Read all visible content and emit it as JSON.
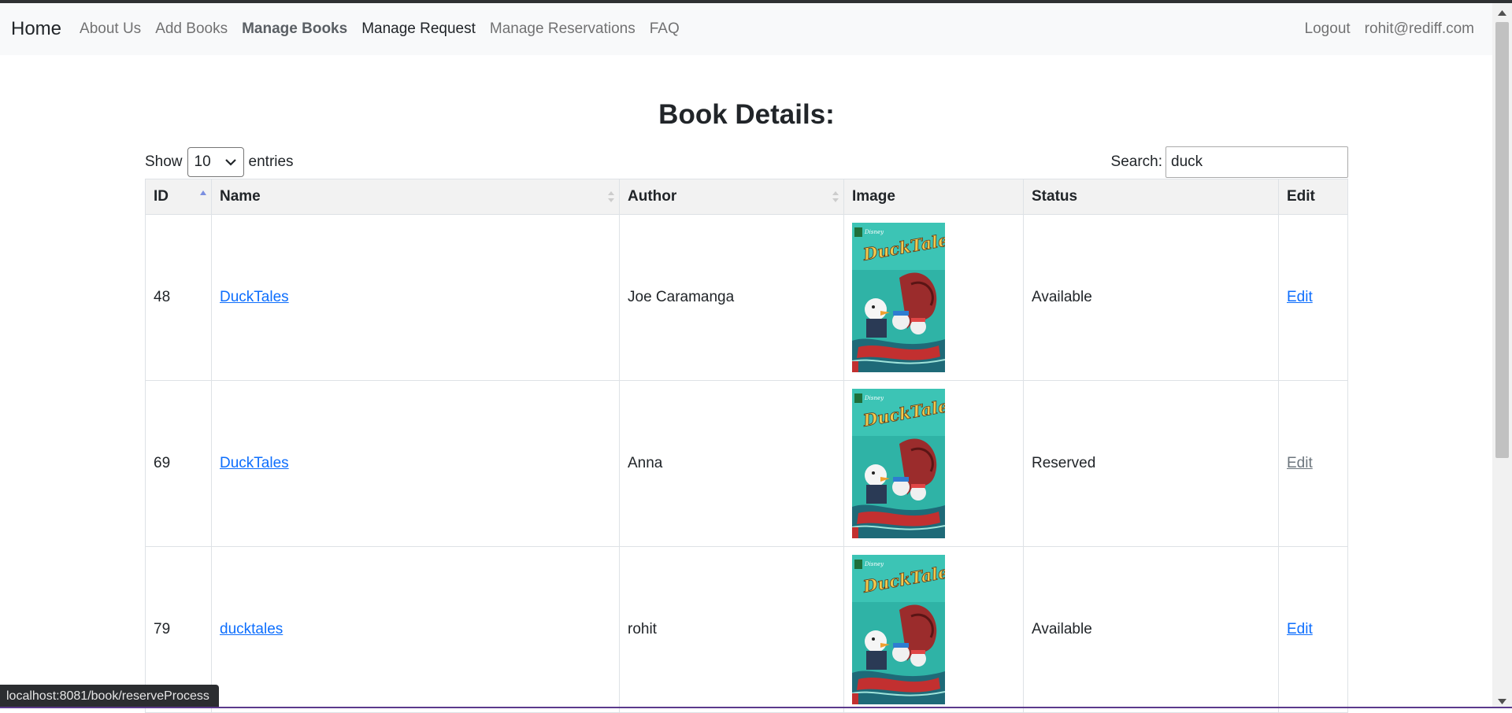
{
  "nav": {
    "brand": "Home",
    "links": [
      "About Us",
      "Add Books",
      "Manage Books",
      "Manage Request",
      "Manage Reservations",
      "FAQ"
    ],
    "logout": "Logout",
    "user": "rohit@rediff.com"
  },
  "page": {
    "title": "Book Details:"
  },
  "controls": {
    "show_label": "Show",
    "entries_value": "10",
    "entries_label": "entries",
    "search_label": "Search:",
    "search_value": "duck"
  },
  "table": {
    "headers": [
      "ID",
      "Name",
      "Author",
      "Image",
      "Status",
      "Edit"
    ],
    "rows": [
      {
        "id": "48",
        "name": "DuckTales",
        "author": "Joe Caramanga",
        "image": "ducktales-cover",
        "status": "Available",
        "edit": "Edit",
        "edit_enabled": true
      },
      {
        "id": "69",
        "name": "DuckTales",
        "author": "Anna",
        "image": "ducktales-cover",
        "status": "Reserved",
        "edit": "Edit",
        "edit_enabled": false
      },
      {
        "id": "79",
        "name": "ducktales",
        "author": "rohit",
        "image": "ducktales-cover",
        "status": "Available",
        "edit": "Edit",
        "edit_enabled": true
      }
    ]
  },
  "cover": {
    "logo_text": "DuckTales",
    "brand_text": "Disney"
  },
  "status_bar": {
    "url": "localhost:8081/book/reserveProcess"
  },
  "colors": {
    "link": "#0d6efd",
    "link_muted": "#6c757d",
    "navbar_bg": "#f8f9fa",
    "header_bg": "#f2f2f2",
    "sort_active": "#7b8fe0"
  },
  "icons": {
    "select": "chevron-down-icon",
    "sort_asc": "sort-asc-icon",
    "sort": "sort-both-icon"
  }
}
